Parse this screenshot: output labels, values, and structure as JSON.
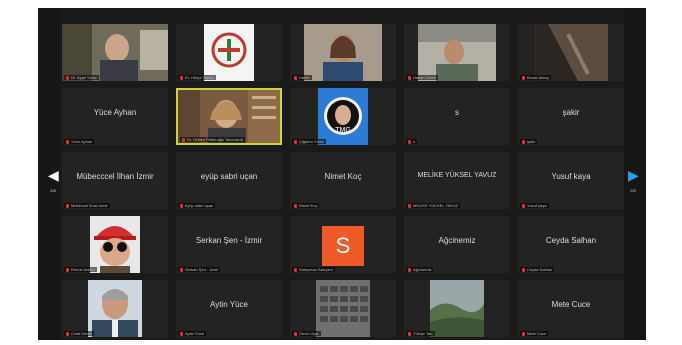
{
  "navigation": {
    "prev_page": "2/8",
    "next_page": "2/8"
  },
  "participants": [
    {
      "name": "",
      "label": "Dr. Ayşe Yıldız",
      "kind": "video"
    },
    {
      "name": "",
      "label": "Dr. Hülya Taşkın",
      "kind": "video"
    },
    {
      "name": "",
      "label": "Hacer",
      "kind": "video"
    },
    {
      "name": "",
      "label": "Hakan Demir",
      "kind": "video"
    },
    {
      "name": "",
      "label": "Burak Aksoy",
      "kind": "video"
    },
    {
      "name": "Yüce Ayhan",
      "label": "Yüce Ayhan",
      "kind": "text"
    },
    {
      "name": "",
      "label": "Dr. Gülten Pekeroğlu Tanrıverdi",
      "kind": "video"
    },
    {
      "name": "",
      "label": "Çiğdem Yıldız",
      "kind": "video"
    },
    {
      "name": "s",
      "label": "s",
      "kind": "text"
    },
    {
      "name": "şakir",
      "label": "şakir",
      "kind": "text"
    },
    {
      "name": "Mübecccel İlhan İzmir",
      "label": "Mübeccel İlhan İzmir",
      "kind": "text"
    },
    {
      "name": "eyüp sabri uçan",
      "label": "eyüp sabri uçan",
      "kind": "text"
    },
    {
      "name": "Nimet Koç",
      "label": "Nimet Koç",
      "kind": "text"
    },
    {
      "name": "MELİKE YÜKSEL YAVUZ",
      "label": "MELİKE YÜKSEL YAVUZ",
      "kind": "text"
    },
    {
      "name": "Yusuf kaya",
      "label": "Yusuf kaya",
      "kind": "text"
    },
    {
      "name": "",
      "label": "Remzi Arslan",
      "kind": "video"
    },
    {
      "name": "Serkan Şen - İzmir",
      "label": "Serkan Şen - İzmir",
      "kind": "text"
    },
    {
      "name": "",
      "label": "Süleyman Sarıçam",
      "kind": "initial",
      "initial": "S"
    },
    {
      "name": "Ağcinemiz",
      "label": "Ağcinemiz",
      "kind": "text"
    },
    {
      "name": "Ceyda Salhan",
      "label": "Ceyda Salhan",
      "kind": "text"
    },
    {
      "name": "",
      "label": "Celal Demir",
      "kind": "video"
    },
    {
      "name": "Aytin Yüce",
      "label": "Aytin Yüce",
      "kind": "text"
    },
    {
      "name": "",
      "label": "Ömer Uçar",
      "kind": "video"
    },
    {
      "name": "",
      "label": "Tülüşe Tan",
      "kind": "video"
    },
    {
      "name": "Mete Cuce",
      "label": "Mete Cuce",
      "kind": "text"
    }
  ]
}
